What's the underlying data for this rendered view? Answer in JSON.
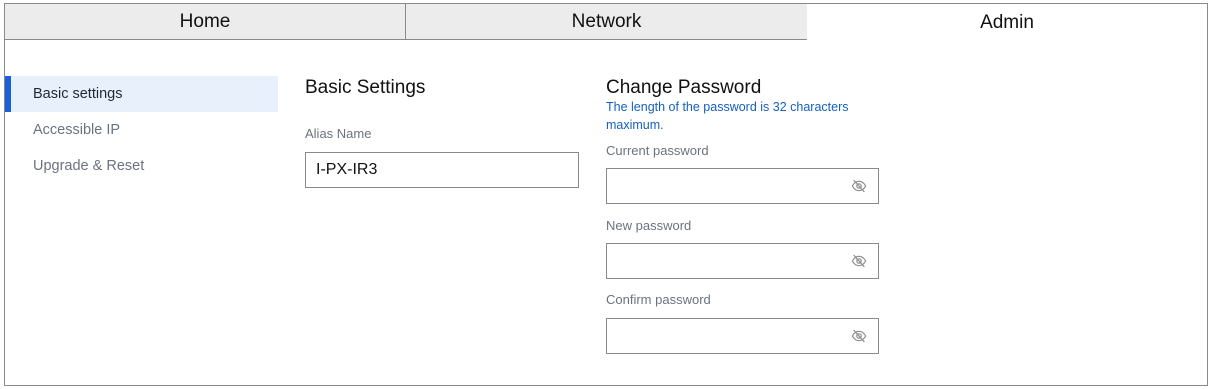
{
  "tabs": [
    {
      "label": "Home",
      "active": false
    },
    {
      "label": "Network",
      "active": false
    },
    {
      "label": "Admin",
      "active": true
    }
  ],
  "sidebar": {
    "items": [
      {
        "label": "Basic settings",
        "active": true
      },
      {
        "label": "Accessible IP",
        "active": false
      },
      {
        "label": "Upgrade & Reset",
        "active": false
      }
    ]
  },
  "basic": {
    "title": "Basic Settings",
    "alias_label": "Alias Name",
    "alias_value": "I-PX-IR3"
  },
  "password": {
    "title": "Change Password",
    "hint": "The length of the password is 32 characters maximum.",
    "current_label": "Current password",
    "new_label": "New password",
    "confirm_label": "Confirm password",
    "current_value": "",
    "new_value": "",
    "confirm_value": "",
    "toggle_icon": "eye-off-icon"
  },
  "colors": {
    "accent": "#1a5fd8",
    "hint": "#1560bd",
    "active_bg": "#e8f0fc",
    "inactive_tab_bg": "#ececec"
  }
}
